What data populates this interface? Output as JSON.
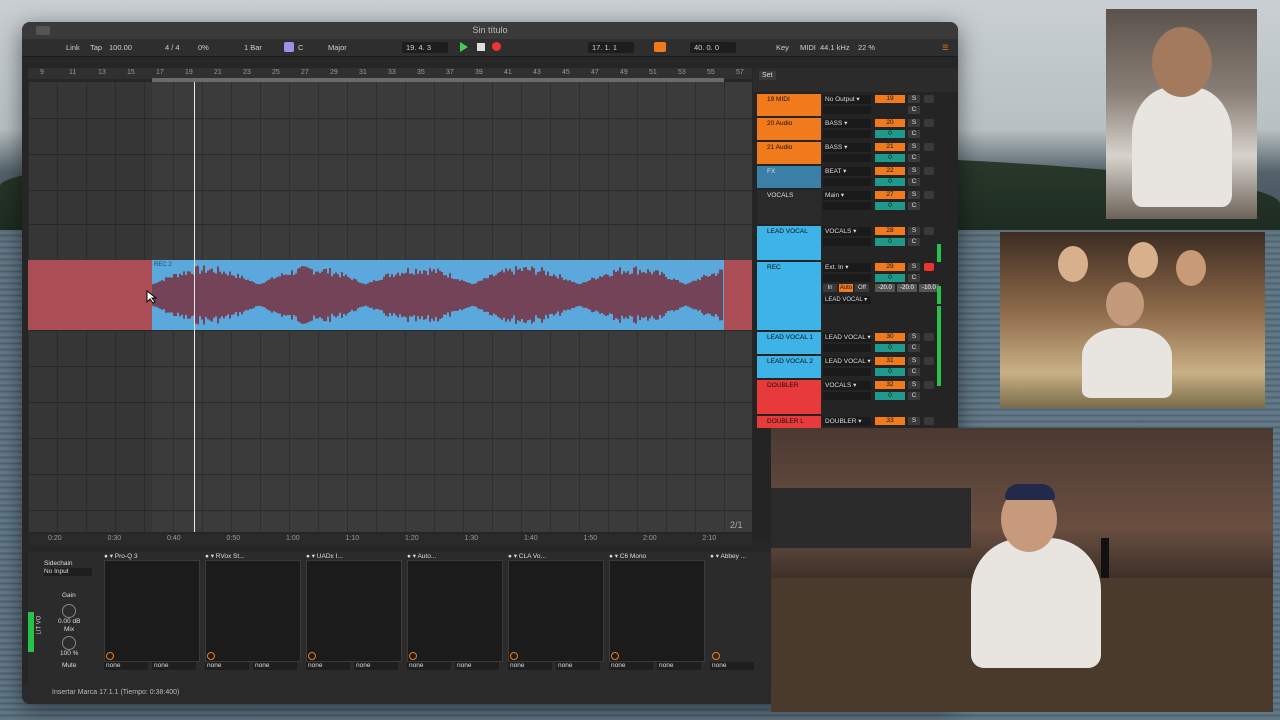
{
  "window": {
    "title": "Sin título"
  },
  "toolbar": {
    "link": "Link",
    "tap": "Tap",
    "tempo": "100.00",
    "time_sig": "4 / 4",
    "swing": "0%",
    "quantize": "1 Bar",
    "key_root": "C",
    "scale": "Major",
    "position": "19.  4.  3",
    "loop_start": "17.  1.  1",
    "loop_length": "40.  0.  0",
    "key_label": "Key",
    "midi_label": "MIDI",
    "sample_rate": "44.1 kHz",
    "cpu": "22 %"
  },
  "ruler": {
    "bars": [
      "9",
      "11",
      "13",
      "15",
      "17",
      "19",
      "21",
      "23",
      "25",
      "27",
      "29",
      "31",
      "33",
      "35",
      "37",
      "39",
      "41",
      "43",
      "45",
      "47",
      "49",
      "51",
      "53",
      "55",
      "57"
    ]
  },
  "clip": {
    "name": "REC 2"
  },
  "timeline": {
    "times": [
      "0:20",
      "0:30",
      "0:40",
      "0:50",
      "1:00",
      "1:10",
      "1:20",
      "1:30",
      "1:40",
      "1:50",
      "2:00",
      "2:10"
    ],
    "pager": "2/1"
  },
  "mixer": {
    "set_label": "Set",
    "tracks": [
      {
        "name": "19 MIDI",
        "route": "No Output",
        "num": "19",
        "color": "#f07a1c"
      },
      {
        "name": "20 Audio",
        "route": "BASS",
        "num": "20",
        "vol": "0",
        "color": "#f07a1c"
      },
      {
        "name": "21 Audio",
        "route": "BASS",
        "num": "21",
        "vol": "0",
        "color": "#f07a1c"
      },
      {
        "name": "FX",
        "route": "BEAT",
        "num": "22",
        "vol": "0",
        "color": "#3a7fa8"
      },
      {
        "name": "VOCALS",
        "route": "Main",
        "num": "27",
        "vol": "0",
        "color": "#2a2a2a"
      },
      {
        "name": "LEAD VOCAL",
        "route": "VOCALS",
        "num": "28",
        "vol": "0",
        "color": "#3eb3e8"
      },
      {
        "name": "REC",
        "route": "Ext. In",
        "num": "29",
        "vol": "0",
        "color": "#3eb3e8",
        "monitor": [
          "In",
          "Auto",
          "Off"
        ],
        "sends": [
          "-20.0",
          "-20.0",
          "-10.0"
        ],
        "out": "LEAD VOCAL"
      },
      {
        "name": "LEAD VOCAL 1",
        "route": "LEAD VOCAL",
        "num": "30",
        "vol": "0",
        "color": "#3eb3e8"
      },
      {
        "name": "LEAD VOCAL 2",
        "route": "LEAD VOCAL",
        "num": "31",
        "vol": "0",
        "color": "#3eb3e8"
      },
      {
        "name": "DOUBLER",
        "route": "VOCALS",
        "num": "32",
        "vol": "0",
        "color": "#e83a3a"
      },
      {
        "name": "DOUBLER L",
        "route": "DOUBLER",
        "num": "33",
        "color": "#e83a3a"
      }
    ]
  },
  "devices": {
    "sidechain": "Sidechain",
    "input": "No Input",
    "gain": "Gain",
    "gain_val": "0.00 dB",
    "mix": "Mix",
    "mix_val": "100 %",
    "mute": "Mute",
    "chain_label": "LIT VO",
    "plugins": [
      "Pro-Q 3",
      "RVox St...",
      "UADx I...",
      "Auto...",
      "CLA Vo...",
      "C6 Mono",
      "Abbey ..."
    ],
    "sel_none": "none"
  },
  "status": {
    "text": "Insertar Marca 17.1.1 (Tiempo: 0:38:400)"
  }
}
